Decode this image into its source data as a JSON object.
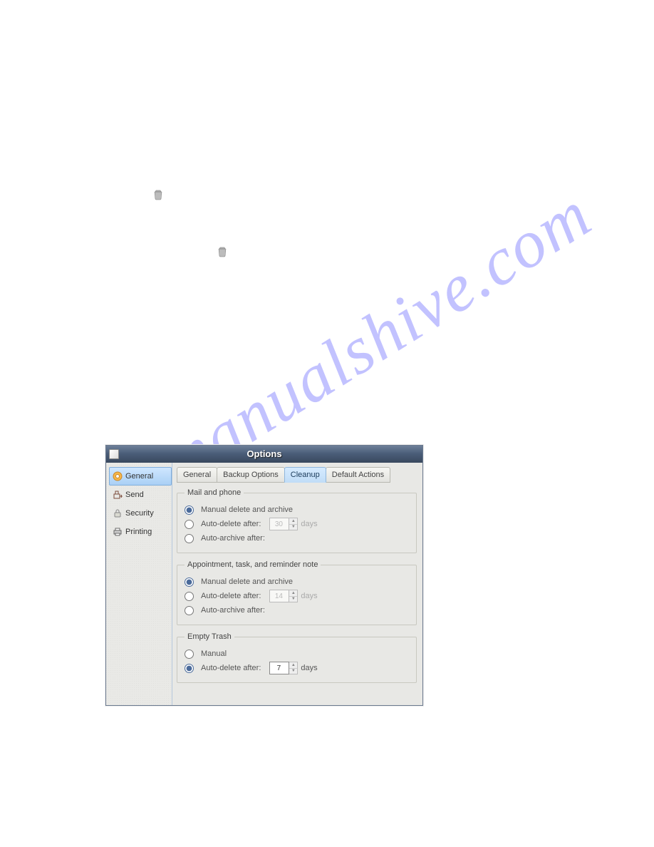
{
  "window": {
    "title": "Options"
  },
  "sidebar": {
    "items": [
      {
        "label": "General"
      },
      {
        "label": "Send"
      },
      {
        "label": "Security"
      },
      {
        "label": "Printing"
      }
    ]
  },
  "tabs": [
    {
      "label": "General"
    },
    {
      "label": "Backup Options"
    },
    {
      "label": "Cleanup"
    },
    {
      "label": "Default Actions"
    }
  ],
  "groups": {
    "mail": {
      "legend": "Mail and phone",
      "manual": "Manual delete and archive",
      "autodelete": "Auto-delete after:",
      "autoarchive": "Auto-archive after:",
      "days_value": "30",
      "days_label": "days"
    },
    "appt": {
      "legend": "Appointment, task, and reminder note",
      "manual": "Manual delete and archive",
      "autodelete": "Auto-delete after:",
      "autoarchive": "Auto-archive after:",
      "days_value": "14",
      "days_label": "days"
    },
    "trash": {
      "legend": "Empty Trash",
      "manual": "Manual",
      "autodelete": "Auto-delete after:",
      "days_value": "7",
      "days_label": "days"
    }
  }
}
